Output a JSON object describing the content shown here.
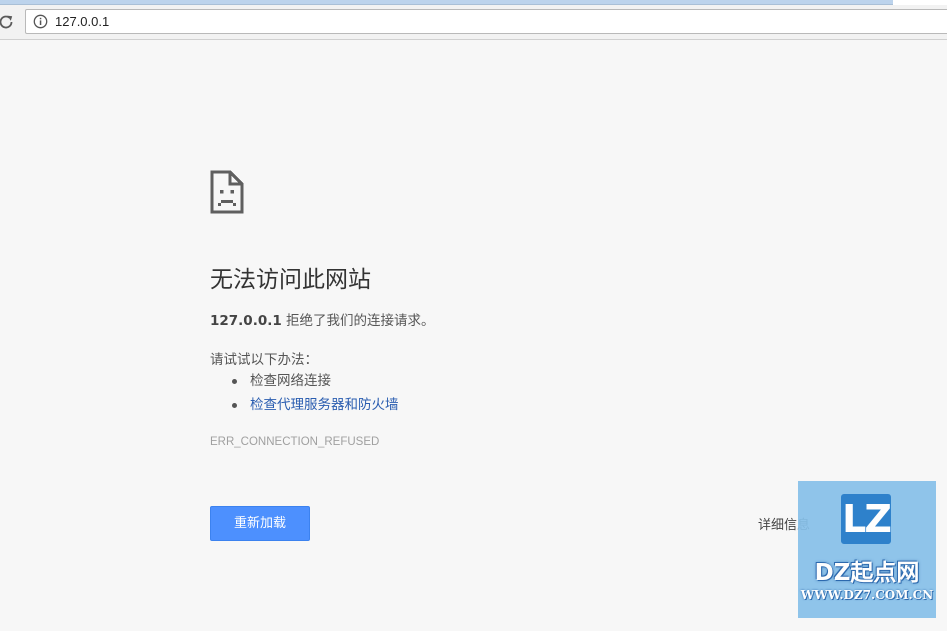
{
  "browser": {
    "url": "127.0.0.1",
    "icons": {
      "reload": "reload-icon",
      "info": "info-icon"
    }
  },
  "error_page": {
    "icon": "sad-page-icon",
    "title": "无法访问此网站",
    "host": "127.0.0.1",
    "summary_rest": " 拒绝了我们的连接请求。",
    "suggestions_intro": "请试试以下办法：",
    "suggestions": [
      {
        "label": "检查网络连接",
        "is_link": false
      },
      {
        "label": "检查代理服务器和防火墙",
        "is_link": true
      }
    ],
    "error_code": "ERR_CONNECTION_REFUSED",
    "reload_label": "重新加载",
    "details_label": "详细信息",
    "link_color": "#2a5db0",
    "button_color": "#4d90fe"
  },
  "watermark": {
    "logo_text": "LZ",
    "name": "DZ起点网",
    "url": "WWW.DZ7.COM.CN"
  }
}
